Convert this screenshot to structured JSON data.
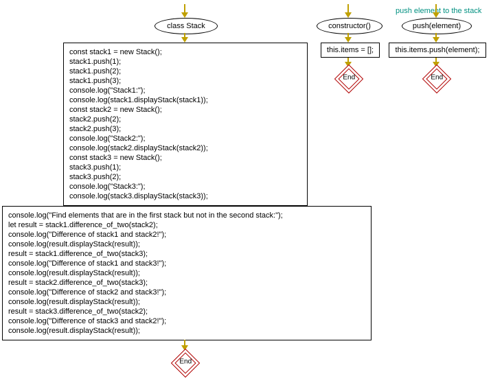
{
  "main": {
    "class_label": "class Stack",
    "code1": "const stack1 = new Stack();\nstack1.push(1);\nstack1.push(2);\nstack1.push(3);\nconsole.log(\"Stack1:\");\nconsole.log(stack1.displayStack(stack1));\nconst stack2 = new Stack();\nstack2.push(2);\nstack2.push(3);\nconsole.log(\"Stack2:\");\nconsole.log(stack2.displayStack(stack2));\nconst stack3 = new Stack();\nstack3.push(1);\nstack3.push(2);\nconsole.log(\"Stack3:\");\nconsole.log(stack3.displayStack(stack3));",
    "code2": "console.log(\"Find elements that are in the first stack but not in the second stack:\");\nlet result = stack1.difference_of_two(stack2);\nconsole.log(\"Difference of stack1 and stack2!\");\nconsole.log(result.displayStack(result));\nresult = stack1.difference_of_two(stack3);\nconsole.log(\"Difference of stack1 and stack3!\");\nconsole.log(result.displayStack(result));\nresult = stack2.difference_of_two(stack3);\nconsole.log(\"Difference of stack2 and stack3!\");\nconsole.log(result.displayStack(result));\nresult = stack3.difference_of_two(stack2);\nconsole.log(\"Difference of stack3 and stack2!\");\nconsole.log(result.displayStack(result));",
    "end": "End"
  },
  "constructor": {
    "label": "constructor()",
    "body": "this.items = [];",
    "end": "End"
  },
  "push": {
    "annotation": "push element to the stack",
    "label": "push(element)",
    "body": "this.items.push(element);",
    "end": "End"
  }
}
